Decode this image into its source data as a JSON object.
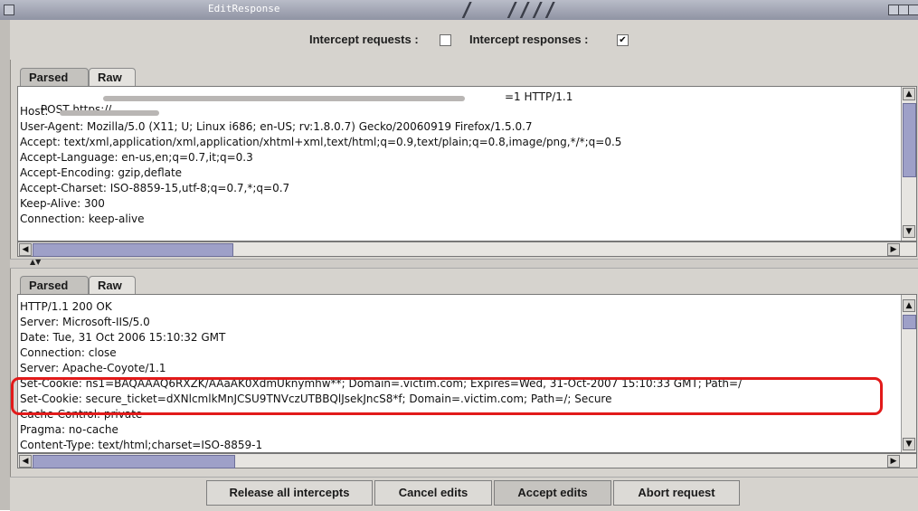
{
  "window": {
    "title": "EditResponse"
  },
  "intercept": {
    "requests_label": "Intercept requests :",
    "requests_checked": false,
    "responses_label": "Intercept responses :",
    "responses_checked": true,
    "check_mark": "✔"
  },
  "request_panel": {
    "tabs": [
      "Parsed",
      "Raw"
    ],
    "selected_tab": "Parsed",
    "lines": [
      "POST https://",
      "Host: ",
      "User-Agent: Mozilla/5.0 (X11; U; Linux i686; en-US; rv:1.8.0.7) Gecko/20060919 Firefox/1.5.0.7",
      "Accept: text/xml,application/xml,application/xhtml+xml,text/html;q=0.9,text/plain;q=0.8,image/png,*/*;q=0.5",
      "Accept-Language: en-us,en;q=0.7,it;q=0.3",
      "Accept-Encoding: gzip,deflate",
      "Accept-Charset: ISO-8859-15,utf-8;q=0.7,*;q=0.7",
      "Keep-Alive: 300",
      "Connection: keep-alive"
    ],
    "post_suffix": "=1 HTTP/1.1"
  },
  "response_panel": {
    "tabs": [
      "Parsed",
      "Raw"
    ],
    "selected_tab": "Parsed",
    "lines": [
      "HTTP/1.1 200 OK",
      "Server: Microsoft-IIS/5.0",
      "Date: Tue, 31 Oct 2006 15:10:32 GMT",
      "Connection: close",
      "Server: Apache-Coyote/1.1",
      "Set-Cookie: ns1=BAQAAAQ6RXZK/AAaAK0XdmUknymhw**; Domain=.victim.com; Expires=Wed, 31-Oct-2007 15:10:33 GMT; Path=/",
      "Set-Cookie: secure_ticket=dXNlcmlkMnJCSU9TNVczUTBBQlJsekJncS8*f; Domain=.victim.com; Path=/; Secure",
      "Cache-Control: private",
      "Pragma: no-cache",
      "Content-Type: text/html;charset=ISO-8859-1"
    ]
  },
  "buttons": {
    "release": "Release all intercepts",
    "cancel": "Cancel edits",
    "accept": "Accept edits",
    "abort": "Abort request"
  },
  "colors": {
    "highlight": "#e21a1a",
    "thumb": "#9ea0c8",
    "window_bg": "#d6d3ce"
  }
}
